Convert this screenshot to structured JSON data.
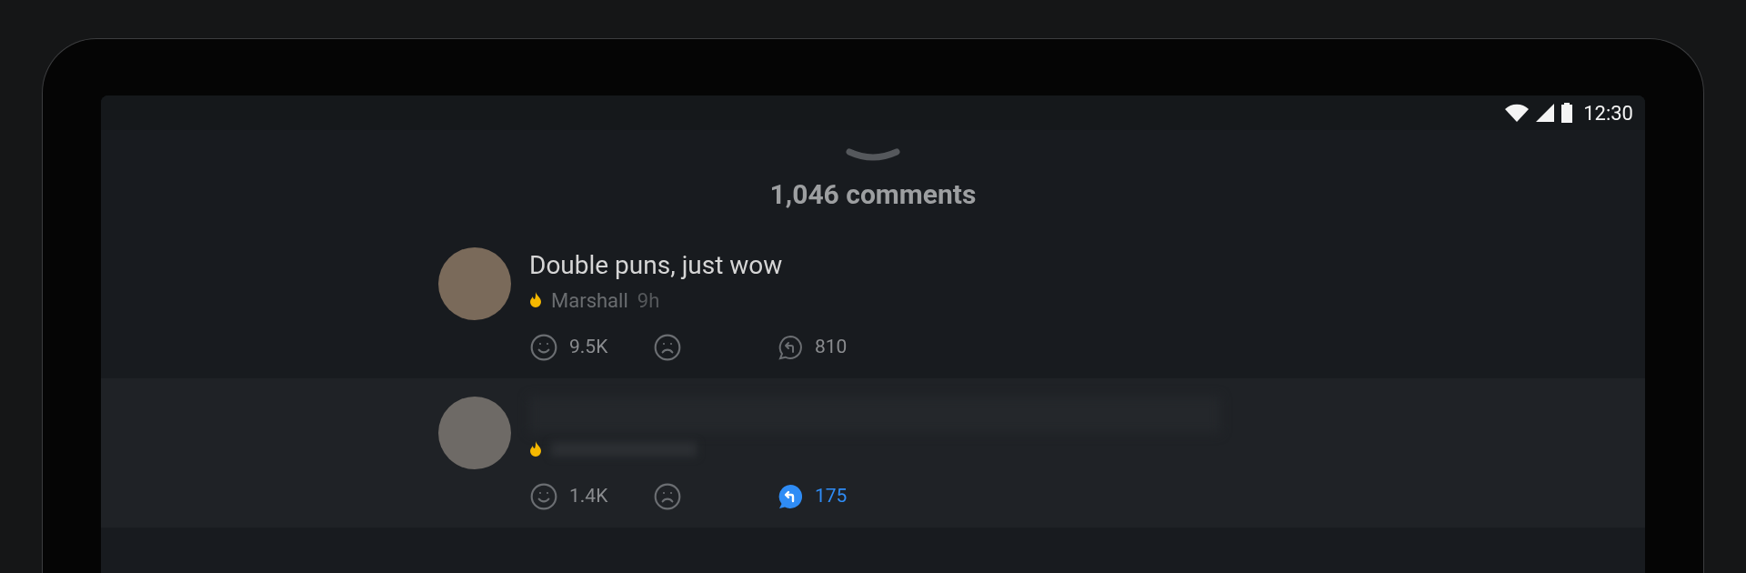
{
  "status_bar": {
    "time": "12:30"
  },
  "header": {
    "title": "1,046 comments"
  },
  "comments": [
    {
      "text": "Double puns, just wow",
      "author": "Marshall",
      "age": "9h",
      "highlighted": false,
      "likes": "9.5K",
      "replies": "810",
      "replied": false
    },
    {
      "highlighted": true,
      "likes": "1.4K",
      "replies": "175",
      "replied": true
    }
  ]
}
